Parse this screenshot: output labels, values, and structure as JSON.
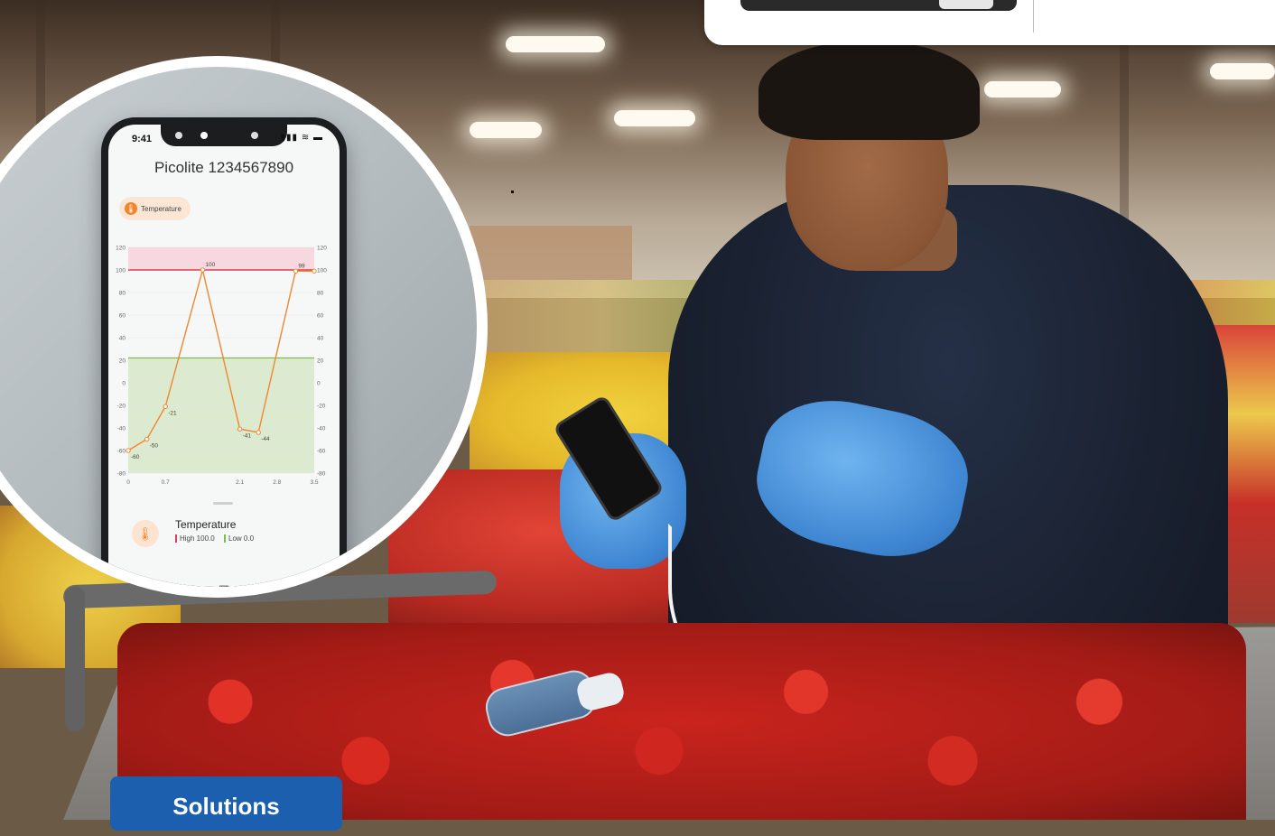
{
  "phone": {
    "time": "9:41",
    "status_icons": "▮▮▮ ≋ ▬",
    "device_title": "Picolite 1234567890",
    "chip_label": "Temperature",
    "chip_icon": "thermometer-icon",
    "legend": {
      "title": "Temperature",
      "high": "High 100.0",
      "low": "Low 0.0"
    },
    "tabs": [
      {
        "icon": "settings-icon",
        "glyph": "⚙"
      },
      {
        "icon": "table-icon",
        "glyph": "▦"
      },
      {
        "icon": "chart-icon",
        "glyph": "📈",
        "active": true
      }
    ]
  },
  "chart_data": {
    "type": "line",
    "x": [
      0,
      0.35,
      0.7,
      1.4,
      2.1,
      2.45,
      3.15,
      3.5
    ],
    "values": [
      -60,
      -50,
      -21,
      100,
      -41,
      -44,
      99,
      99
    ],
    "point_labels": [
      "-60",
      "-50",
      "-21",
      "100",
      "-41",
      "-44",
      "99",
      ""
    ],
    "x_ticks": [
      "0",
      "0.7",
      "2.1",
      "2.8",
      "3.5"
    ],
    "y_ticks_left": [
      "120",
      "100",
      "80",
      "60",
      "40",
      "20",
      "0",
      "-20",
      "-40",
      "-60",
      "-80"
    ],
    "y_ticks_right": [
      "120",
      "100",
      "80",
      "60",
      "40",
      "20",
      "0",
      "-20",
      "-40",
      "-60",
      "-80"
    ],
    "ylim": [
      -80,
      120
    ],
    "xlim": [
      0,
      3.5
    ],
    "high_threshold": 100,
    "safe_band": [
      -80,
      22
    ],
    "colors": {
      "line": "#f0862e",
      "high_band": "#f7d8de",
      "high_line": "#d9415a",
      "safe_band": "#dcebcf",
      "safe_line": "#7bbf4a"
    }
  },
  "button": {
    "label": "Solutions",
    "color": "#1b5fae"
  }
}
